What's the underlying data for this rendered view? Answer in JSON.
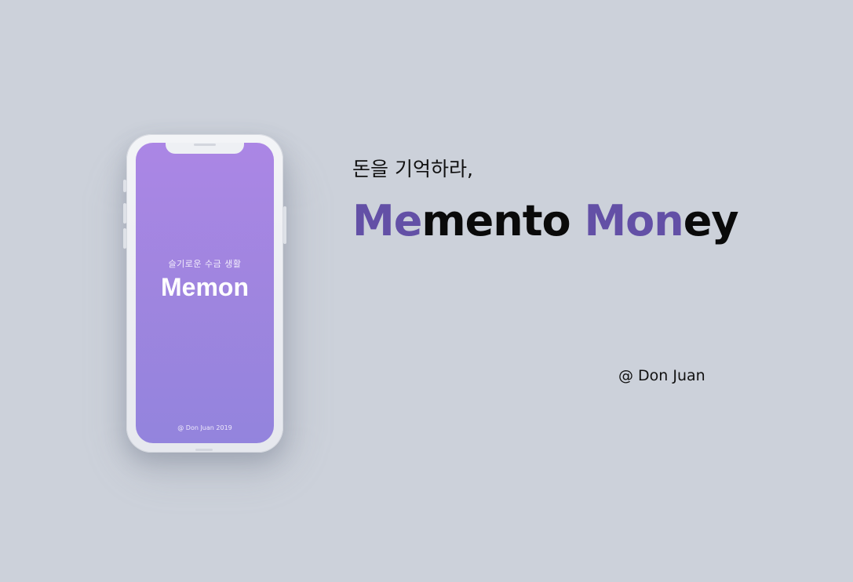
{
  "phone": {
    "tagline": "슬기로운 수금 생활",
    "logo": "Memon",
    "footer": "@ Don Juan 2019"
  },
  "hero": {
    "subtitle": "돈을 기억하라,",
    "headline": {
      "part1_accent": "Me",
      "part1_rest": "mento",
      "part2_accent": "Mon",
      "part2_rest": "ey"
    },
    "author": "@ Don Juan"
  },
  "colors": {
    "background": "#ccd1da",
    "accent": "#6350a6",
    "screen_top": "#ab86e5",
    "screen_bottom": "#9384dd"
  }
}
